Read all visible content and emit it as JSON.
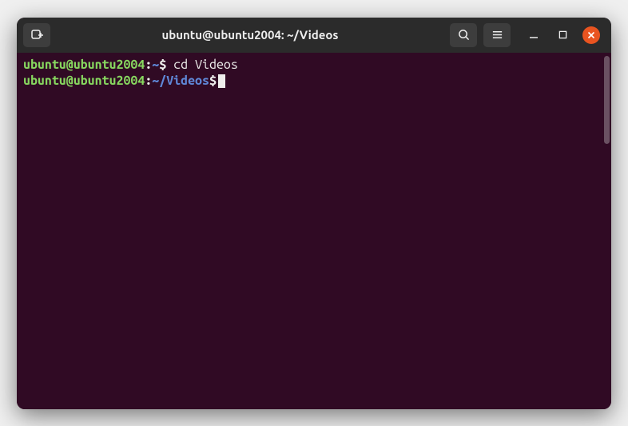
{
  "titlebar": {
    "title": "ubuntu@ubuntu2004: ~/Videos"
  },
  "terminal": {
    "line1": {
      "userhost": "ubuntu@ubuntu2004",
      "colon": ":",
      "path": "~",
      "dollar": "$",
      "command": " cd Videos"
    },
    "line2": {
      "userhost": "ubuntu@ubuntu2004",
      "colon": ":",
      "path": "~/Videos",
      "dollar": "$"
    }
  }
}
